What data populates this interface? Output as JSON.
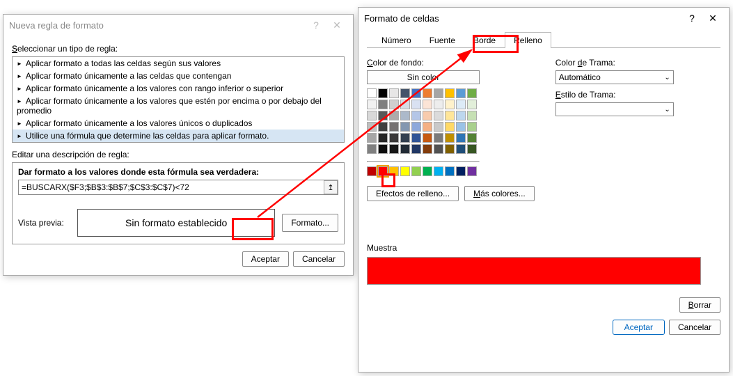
{
  "dialog1": {
    "title": "Nueva regla de formato",
    "select_type_label": "Seleccionar un tipo de regla:",
    "rules": [
      "Aplicar formato a todas las celdas según sus valores",
      "Aplicar formato únicamente a las celdas que contengan",
      "Aplicar formato únicamente a los valores con rango inferior o superior",
      "Aplicar formato únicamente a los valores que estén por encima o por debajo del promedio",
      "Aplicar formato únicamente a los valores únicos o duplicados",
      "Utilice una fórmula que determine las celdas para aplicar formato."
    ],
    "edit_desc_label": "Editar una descripción de regla:",
    "formula_label": "Dar formato a los valores donde esta fórmula sea verdadera:",
    "formula_value": "=BUSCARX($F3;$B$3:$B$7;$C$3:$C$7)<72",
    "preview_label": "Vista previa:",
    "preview_text": "Sin formato establecido",
    "format_btn": "Formato...",
    "ok": "Aceptar",
    "cancel": "Cancelar"
  },
  "dialog2": {
    "title": "Formato de celdas",
    "tabs": {
      "numero": "Número",
      "fuente": "Fuente",
      "borde": "Borde",
      "relleno": "Relleno"
    },
    "bg_label": "Color de fondo:",
    "no_color": "Sin color",
    "effects": "Efectos de relleno...",
    "more_colors": "Más colores...",
    "pattern_color": "Color de Trama:",
    "pattern_color_value": "Automático",
    "pattern_style": "Estilo de Trama:",
    "sample": "Muestra",
    "clear": "Borrar",
    "ok": "Aceptar",
    "cancel": "Cancelar",
    "theme_colors": [
      [
        "#ffffff",
        "#000000",
        "#e7e6e6",
        "#44546a",
        "#4472c4",
        "#ed7d31",
        "#a5a5a5",
        "#ffc000",
        "#5b9bd5",
        "#70ad47"
      ],
      [
        "#f2f2f2",
        "#7f7f7f",
        "#d0cece",
        "#d6dce4",
        "#d9e1f2",
        "#fce4d6",
        "#ededed",
        "#fff2cc",
        "#ddebf7",
        "#e2efda"
      ],
      [
        "#d9d9d9",
        "#595959",
        "#aeaaaa",
        "#acb9ca",
        "#b4c6e7",
        "#f8cbad",
        "#dbdbdb",
        "#ffe699",
        "#bdd7ee",
        "#c6e0b4"
      ],
      [
        "#bfbfbf",
        "#404040",
        "#757171",
        "#8497b0",
        "#8ea9db",
        "#f4b084",
        "#c9c9c9",
        "#ffd966",
        "#9bc2e6",
        "#a9d08e"
      ],
      [
        "#a6a6a6",
        "#262626",
        "#3a3838",
        "#333f4f",
        "#305496",
        "#c65911",
        "#7b7b7b",
        "#bf8f00",
        "#2f75b5",
        "#548235"
      ],
      [
        "#808080",
        "#0d0d0d",
        "#161616",
        "#222b35",
        "#203764",
        "#833c0c",
        "#525252",
        "#806000",
        "#1f4e78",
        "#375623"
      ]
    ],
    "standard_colors": [
      "#c00000",
      "#ff0000",
      "#ffc000",
      "#ffff00",
      "#92d050",
      "#00b050",
      "#00b0f0",
      "#0070c0",
      "#002060",
      "#7030a0"
    ],
    "selected_standard_index": 1
  }
}
